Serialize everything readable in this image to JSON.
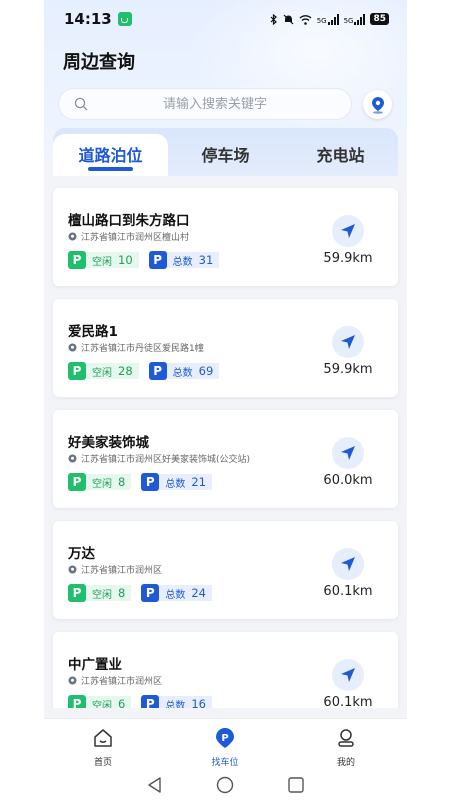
{
  "status_bar": {
    "time": "14:13",
    "network": "5G",
    "battery": "85"
  },
  "header": {
    "title": "周边查询"
  },
  "search": {
    "placeholder": "请输入搜索关键字",
    "value": ""
  },
  "tabs": [
    {
      "label": "道路泊位",
      "active": true
    },
    {
      "label": "停车场",
      "active": false
    },
    {
      "label": "充电站",
      "active": false
    }
  ],
  "labels": {
    "free": "空闲",
    "total": "总数"
  },
  "parking_spots": [
    {
      "name": "檀山路口到朱方路口",
      "address": "江苏省镇江市润州区檀山村",
      "free": "10",
      "total": "31",
      "distance": "59.9km"
    },
    {
      "name": "爱民路1",
      "address": "江苏省镇江市丹徒区爱民路1幢",
      "free": "28",
      "total": "69",
      "distance": "59.9km"
    },
    {
      "name": "好美家装饰城",
      "address": "江苏省镇江市润州区好美家装饰城(公交站)",
      "free": "8",
      "total": "21",
      "distance": "60.0km"
    },
    {
      "name": "万达",
      "address": "江苏省镇江市润州区",
      "free": "8",
      "total": "24",
      "distance": "60.1km"
    },
    {
      "name": "中广置业",
      "address": "江苏省镇江市润州区",
      "free": "6",
      "total": "16",
      "distance": "60.1km"
    }
  ],
  "bottom_nav": [
    {
      "label": "首页",
      "icon": "home-icon",
      "active": false
    },
    {
      "label": "找车位",
      "icon": "parking-icon",
      "active": true
    },
    {
      "label": "我的",
      "icon": "profile-icon",
      "active": false
    }
  ],
  "colors": {
    "accent": "#1e5ad6",
    "free": "#1fbf6e"
  }
}
